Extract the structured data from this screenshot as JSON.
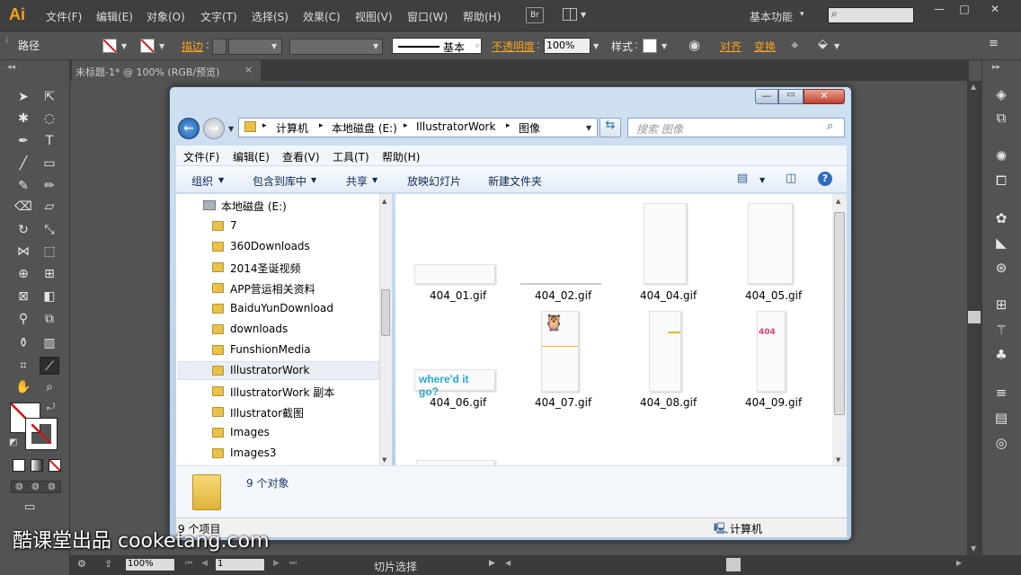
{
  "app": {
    "logo": "Ai",
    "menu": [
      "文件(F)",
      "编辑(E)",
      "对象(O)",
      "文字(T)",
      "选择(S)",
      "效果(C)",
      "视图(V)",
      "窗口(W)",
      "帮助(H)"
    ],
    "bridge_label": "Br",
    "workspace": "基本功能",
    "window_controls": [
      "—",
      "□",
      "✕"
    ]
  },
  "control_bar": {
    "selection_type": "路径",
    "stroke_label": "描边",
    "stroke_style": "基本",
    "opacity_label": "不透明度",
    "opacity_value": "100%",
    "style_label": "样式",
    "align_label": "对齐",
    "transform_label": "变换"
  },
  "document": {
    "tab_title": "未标题-1* @ 100% (RGB/预览)",
    "tab_close": "×"
  },
  "status_bar": {
    "zoom": "100%",
    "page": "1",
    "tool_status": "切片选择"
  },
  "explorer": {
    "breadcrumb": [
      "计算机",
      "本地磁盘 (E:)",
      "IllustratorWork",
      "图像"
    ],
    "search_placeholder": "搜索 图像",
    "menu": [
      "文件(F)",
      "编辑(E)",
      "查看(V)",
      "工具(T)",
      "帮助(H)"
    ],
    "toolbar": [
      "组织",
      "包含到库中",
      "共享",
      "放映幻灯片",
      "新建文件夹"
    ],
    "nav_root": "本地磁盘 (E:)",
    "nav_items": [
      "7",
      "360Downloads",
      "2014圣诞视频",
      "APP营运相关资料",
      "BaiduYunDownload",
      "downloads",
      "FunshionMedia",
      "IllustratorWork",
      "IllustratorWork 副本",
      "Illustrator截图",
      "Images",
      "Images3"
    ],
    "files": [
      "404_01.gif",
      "404_02.gif",
      "404_04.gif",
      "404_05.gif",
      "404_06.gif",
      "404_07.gif",
      "404_08.gif",
      "404_09.gif"
    ],
    "thumb_text_06": "where'd it go?",
    "thumb_text_09": "404",
    "details_count": "9 个对象",
    "status_count": "9 个项目",
    "status_location": "计算机"
  },
  "watermark": "酷课堂出品 cooketang.com",
  "colors": {
    "accent": "#f7a21b",
    "chrome": "#535353",
    "link_blue": "#1e6fb8"
  }
}
